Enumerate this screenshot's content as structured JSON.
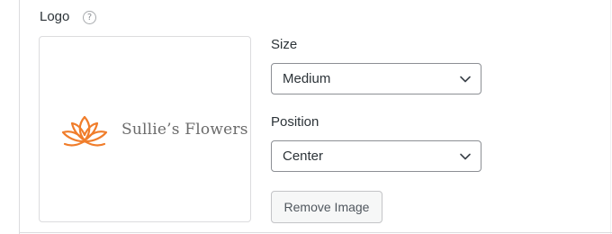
{
  "logo_section": {
    "heading": "Logo",
    "help_icon_glyph": "?",
    "help_icon": "question-circle-icon"
  },
  "preview": {
    "brand_name": "Sullie’s Flowers",
    "brand_icon": "lotus-icon",
    "brand_color": "#f07d2b",
    "brand_text_color": "#6b6b6b"
  },
  "size": {
    "label": "Size",
    "selected": "Medium",
    "chevron_icon": "chevron-down-icon"
  },
  "position": {
    "label": "Position",
    "selected": "Center",
    "chevron_icon": "chevron-down-icon"
  },
  "actions": {
    "remove_label": "Remove Image"
  }
}
